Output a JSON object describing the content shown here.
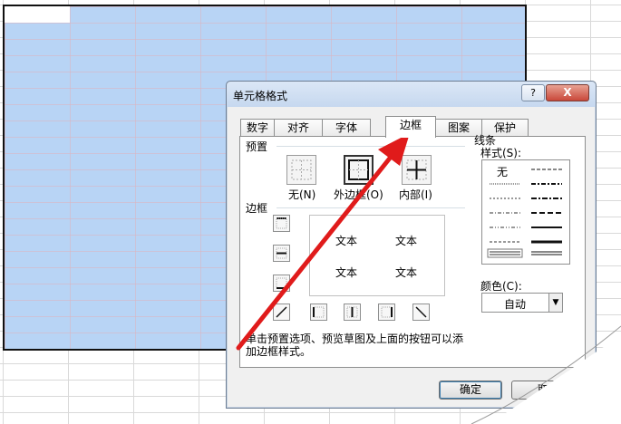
{
  "dialog": {
    "title": "单元格格式",
    "help_label": "?",
    "close_label": "X",
    "tabs": [
      {
        "label": "数字"
      },
      {
        "label": "对齐"
      },
      {
        "label": "字体"
      },
      {
        "label": "边框",
        "active": true
      },
      {
        "label": "图案"
      },
      {
        "label": "保护"
      }
    ]
  },
  "border_tab": {
    "presets_title": "预置",
    "presets": [
      {
        "label": "无(N)"
      },
      {
        "label": "外边框(O)"
      },
      {
        "label": "内部(I)"
      }
    ],
    "border_title": "边框",
    "preview_texts": [
      "文本",
      "文本",
      "文本",
      "文本"
    ],
    "hint": "单击预置选项、预览草图及上面的按钮可以添加边框样式。",
    "line_title": "线条",
    "style_label": "样式(S):",
    "style_none": "无",
    "color_label": "颜色(C):",
    "color_value": "自动"
  },
  "buttons": {
    "ok": "确定",
    "cancel": "取"
  },
  "annotation": {
    "arrow_color": "#e01b1b"
  },
  "colors": {
    "selection": "#b8d4f5",
    "accent": "#3c7fb1"
  }
}
